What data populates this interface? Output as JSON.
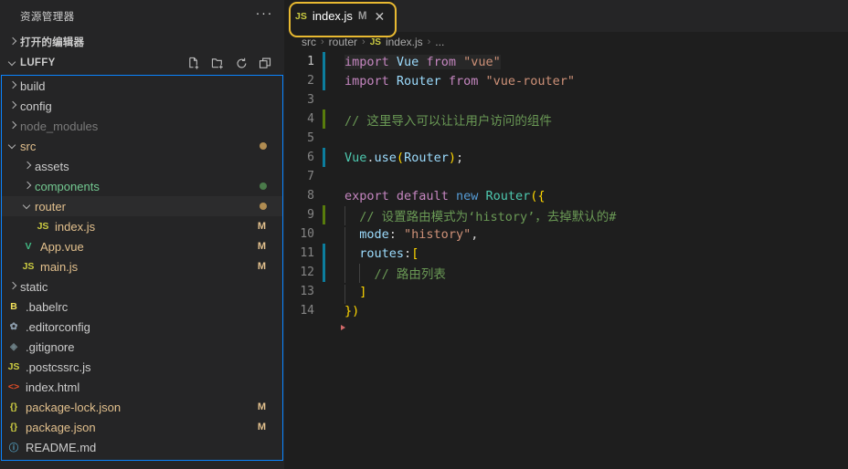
{
  "sidebar": {
    "title": "资源管理器",
    "more_label": "···",
    "open_editors": {
      "label": "打开的编辑器"
    },
    "project": {
      "label": "LUFFY",
      "actions": [
        {
          "name": "new-file-icon",
          "title": "新建文件"
        },
        {
          "name": "new-folder-icon",
          "title": "新建文件夹"
        },
        {
          "name": "refresh-icon",
          "title": "刷新"
        },
        {
          "name": "collapse-all-icon",
          "title": "全部折叠"
        }
      ]
    },
    "tree": [
      {
        "label": "build",
        "indent": 1,
        "kind": "folder",
        "expanded": false,
        "icon": "",
        "icon_color": "",
        "badge": "",
        "badge_color": "",
        "dot": "",
        "name_color": "#cccccc",
        "selected": false
      },
      {
        "label": "config",
        "indent": 1,
        "kind": "folder",
        "expanded": false,
        "icon": "",
        "icon_color": "",
        "badge": "",
        "badge_color": "",
        "dot": "",
        "name_color": "#cccccc",
        "selected": false
      },
      {
        "label": "node_modules",
        "indent": 1,
        "kind": "folder",
        "expanded": false,
        "icon": "",
        "icon_color": "",
        "badge": "",
        "badge_color": "",
        "dot": "",
        "name_color": "#7a7a7a",
        "selected": false
      },
      {
        "label": "src",
        "indent": 1,
        "kind": "folder",
        "expanded": true,
        "icon": "",
        "icon_color": "",
        "badge": "",
        "badge_color": "",
        "dot": "#b08c52",
        "name_color": "#e2c08d",
        "selected": false
      },
      {
        "label": "assets",
        "indent": 2,
        "kind": "folder",
        "expanded": false,
        "icon": "",
        "icon_color": "",
        "badge": "",
        "badge_color": "",
        "dot": "",
        "name_color": "#cccccc",
        "selected": false
      },
      {
        "label": "components",
        "indent": 2,
        "kind": "folder",
        "expanded": false,
        "icon": "",
        "icon_color": "",
        "badge": "",
        "badge_color": "",
        "dot": "#4a7a4a",
        "name_color": "#73c991",
        "selected": false
      },
      {
        "label": "router",
        "indent": 2,
        "kind": "folder",
        "expanded": true,
        "icon": "",
        "icon_color": "",
        "badge": "",
        "badge_color": "",
        "dot": "#b08c52",
        "name_color": "#e2c08d",
        "selected": true
      },
      {
        "label": "index.js",
        "indent": 3,
        "kind": "file",
        "expanded": false,
        "icon": "JS",
        "icon_color": "#cbcb41",
        "badge": "M",
        "badge_color": "#e2c08d",
        "dot": "",
        "name_color": "#e2c08d",
        "selected": false
      },
      {
        "label": "App.vue",
        "indent": 2,
        "kind": "file",
        "expanded": false,
        "icon": "V",
        "icon_color": "#41b883",
        "badge": "M",
        "badge_color": "#e2c08d",
        "dot": "",
        "name_color": "#e2c08d",
        "selected": false
      },
      {
        "label": "main.js",
        "indent": 2,
        "kind": "file",
        "expanded": false,
        "icon": "JS",
        "icon_color": "#cbcb41",
        "badge": "M",
        "badge_color": "#e2c08d",
        "dot": "",
        "name_color": "#e2c08d",
        "selected": false
      },
      {
        "label": "static",
        "indent": 1,
        "kind": "folder",
        "expanded": false,
        "icon": "",
        "icon_color": "",
        "badge": "",
        "badge_color": "",
        "dot": "",
        "name_color": "#cccccc",
        "selected": false
      },
      {
        "label": ".babelrc",
        "indent": 1,
        "kind": "file",
        "expanded": false,
        "icon": "B",
        "icon_color": "#f1e05a",
        "badge": "",
        "badge_color": "",
        "dot": "",
        "name_color": "#cccccc",
        "selected": false
      },
      {
        "label": ".editorconfig",
        "indent": 1,
        "kind": "file",
        "expanded": false,
        "icon": "✿",
        "icon_color": "#8a9aa9",
        "badge": "",
        "badge_color": "",
        "dot": "",
        "name_color": "#cccccc",
        "selected": false
      },
      {
        "label": ".gitignore",
        "indent": 1,
        "kind": "file",
        "expanded": false,
        "icon": "◈",
        "icon_color": "#6d8086",
        "badge": "",
        "badge_color": "",
        "dot": "",
        "name_color": "#cccccc",
        "selected": false
      },
      {
        "label": ".postcssrc.js",
        "indent": 1,
        "kind": "file",
        "expanded": false,
        "icon": "JS",
        "icon_color": "#cbcb41",
        "badge": "",
        "badge_color": "",
        "dot": "",
        "name_color": "#cccccc",
        "selected": false
      },
      {
        "label": "index.html",
        "indent": 1,
        "kind": "file",
        "expanded": false,
        "icon": "<>",
        "icon_color": "#e44d26",
        "badge": "",
        "badge_color": "",
        "dot": "",
        "name_color": "#cccccc",
        "selected": false
      },
      {
        "label": "package-lock.json",
        "indent": 1,
        "kind": "file",
        "expanded": false,
        "icon": "{}",
        "icon_color": "#cbcb41",
        "badge": "M",
        "badge_color": "#e2c08d",
        "dot": "",
        "name_color": "#e2c08d",
        "selected": false
      },
      {
        "label": "package.json",
        "indent": 1,
        "kind": "file",
        "expanded": false,
        "icon": "{}",
        "icon_color": "#cbcb41",
        "badge": "M",
        "badge_color": "#e2c08d",
        "dot": "",
        "name_color": "#e2c08d",
        "selected": false
      },
      {
        "label": "README.md",
        "indent": 1,
        "kind": "file",
        "expanded": false,
        "icon": "ⓘ",
        "icon_color": "#519aba",
        "badge": "",
        "badge_color": "",
        "dot": "",
        "name_color": "#cccccc",
        "selected": false
      }
    ]
  },
  "editor": {
    "tab": {
      "icon_label": "JS",
      "filename": "index.js",
      "modified_badge": "M",
      "close_label": "✕",
      "highlight_color": "#e8b931"
    },
    "breadcrumb": {
      "items": [
        "src",
        "router",
        "index.js",
        "..."
      ],
      "file_icon_label": "JS",
      "separator": "›"
    },
    "lines": [
      {
        "n": "1",
        "gutter": "mod",
        "highlight": true,
        "indent_guides": 0,
        "tokens": [
          {
            "t": "import",
            "c": "kw"
          },
          {
            "t": " ",
            "c": "plain"
          },
          {
            "t": "Vue",
            "c": "var"
          },
          {
            "t": " ",
            "c": "plain"
          },
          {
            "t": "from",
            "c": "kw"
          },
          {
            "t": " ",
            "c": "plain"
          },
          {
            "t": "\"vue\"",
            "c": "str"
          }
        ]
      },
      {
        "n": "2",
        "gutter": "mod",
        "highlight": false,
        "indent_guides": 0,
        "tokens": [
          {
            "t": "import",
            "c": "kw"
          },
          {
            "t": " ",
            "c": "plain"
          },
          {
            "t": "Router",
            "c": "var"
          },
          {
            "t": " ",
            "c": "plain"
          },
          {
            "t": "from",
            "c": "kw"
          },
          {
            "t": " ",
            "c": "plain"
          },
          {
            "t": "\"vue-router\"",
            "c": "str"
          }
        ]
      },
      {
        "n": "3",
        "gutter": "",
        "highlight": false,
        "indent_guides": 0,
        "tokens": []
      },
      {
        "n": "4",
        "gutter": "add",
        "highlight": false,
        "indent_guides": 0,
        "tokens": [
          {
            "t": "// 这里导入可以让让用户访问的组件",
            "c": "cmt"
          }
        ]
      },
      {
        "n": "5",
        "gutter": "",
        "highlight": false,
        "indent_guides": 0,
        "tokens": []
      },
      {
        "n": "6",
        "gutter": "mod",
        "highlight": false,
        "indent_guides": 0,
        "tokens": [
          {
            "t": "Vue",
            "c": "type"
          },
          {
            "t": ".",
            "c": "plain"
          },
          {
            "t": "use",
            "c": "var"
          },
          {
            "t": "(",
            "c": "pun"
          },
          {
            "t": "Router",
            "c": "var"
          },
          {
            "t": ")",
            "c": "pun"
          },
          {
            "t": ";",
            "c": "plain"
          }
        ]
      },
      {
        "n": "7",
        "gutter": "",
        "highlight": false,
        "indent_guides": 0,
        "tokens": []
      },
      {
        "n": "8",
        "gutter": "",
        "highlight": false,
        "indent_guides": 0,
        "tokens": [
          {
            "t": "export",
            "c": "kw"
          },
          {
            "t": " ",
            "c": "plain"
          },
          {
            "t": "default",
            "c": "kw"
          },
          {
            "t": " ",
            "c": "plain"
          },
          {
            "t": "new",
            "c": "blue"
          },
          {
            "t": " ",
            "c": "plain"
          },
          {
            "t": "Router",
            "c": "type"
          },
          {
            "t": "(",
            "c": "pun"
          },
          {
            "t": "{",
            "c": "pun"
          }
        ]
      },
      {
        "n": "9",
        "gutter": "add",
        "highlight": false,
        "indent_guides": 1,
        "tokens": [
          {
            "t": "  // 设置路由模式为‘history’，去掉默认的#",
            "c": "cmt"
          }
        ]
      },
      {
        "n": "10",
        "gutter": "",
        "highlight": false,
        "indent_guides": 1,
        "tokens": [
          {
            "t": "  ",
            "c": "plain"
          },
          {
            "t": "mode",
            "c": "var"
          },
          {
            "t": ": ",
            "c": "plain"
          },
          {
            "t": "\"history\"",
            "c": "str"
          },
          {
            "t": ",",
            "c": "plain"
          }
        ]
      },
      {
        "n": "11",
        "gutter": "mod",
        "highlight": false,
        "indent_guides": 1,
        "tokens": [
          {
            "t": "  ",
            "c": "plain"
          },
          {
            "t": "routes",
            "c": "var"
          },
          {
            "t": ":",
            "c": "plain"
          },
          {
            "t": "[",
            "c": "pun"
          }
        ]
      },
      {
        "n": "12",
        "gutter": "mod",
        "highlight": false,
        "indent_guides": 2,
        "tokens": [
          {
            "t": "    // 路由列表",
            "c": "cmt"
          }
        ]
      },
      {
        "n": "13",
        "gutter": "",
        "highlight": false,
        "indent_guides": 1,
        "tokens": [
          {
            "t": "  ",
            "c": "plain"
          },
          {
            "t": "]",
            "c": "pun"
          }
        ]
      },
      {
        "n": "14",
        "gutter": "",
        "highlight": false,
        "indent_guides": 0,
        "tokens": [
          {
            "t": "}",
            "c": "pun"
          },
          {
            "t": ")",
            "c": "pun"
          }
        ]
      }
    ]
  }
}
